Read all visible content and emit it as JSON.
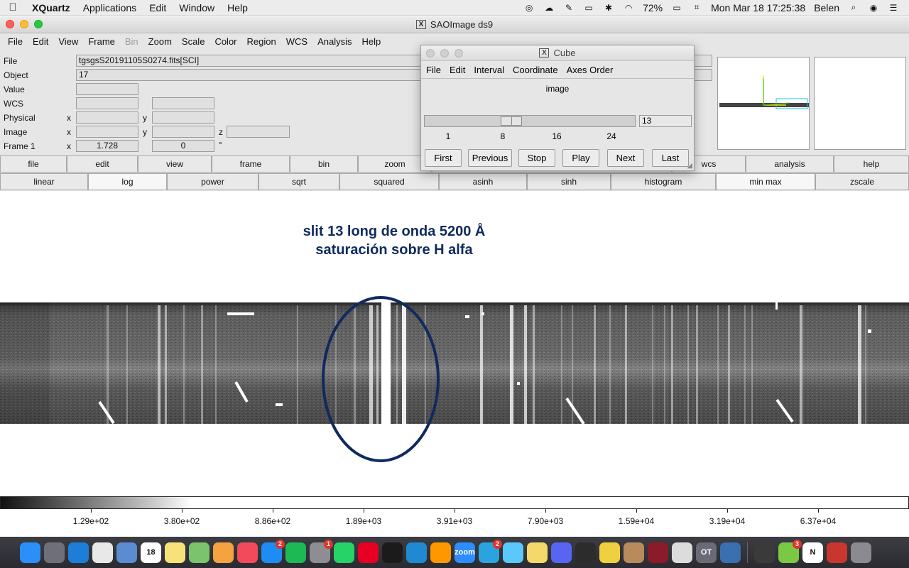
{
  "menubar": {
    "app": "XQuartz",
    "items": [
      "Applications",
      "Edit",
      "Window",
      "Help"
    ],
    "battery": "72%",
    "clock": "Mon Mar 18  17:25:38",
    "user": "Belen"
  },
  "window": {
    "title": "SAOImage ds9",
    "menu": [
      "File",
      "Edit",
      "View",
      "Frame",
      "Bin",
      "Zoom",
      "Scale",
      "Color",
      "Region",
      "WCS",
      "Analysis",
      "Help"
    ]
  },
  "info": {
    "labels": {
      "file": "File",
      "object": "Object",
      "value": "Value",
      "wcs": "WCS",
      "physical": "Physical",
      "image": "Image",
      "frame": "Frame 1",
      "x": "x",
      "y": "y",
      "z": "z",
      "deg": "°"
    },
    "file": "tgsgsS20191105S0274.fits[SCI]",
    "object": "17",
    "frame_zoom": "1.728",
    "frame_angle": "0"
  },
  "buttons": {
    "row1": [
      "file",
      "edit",
      "view",
      "frame",
      "bin",
      "zoom",
      "",
      "wcs",
      "analysis",
      "help"
    ],
    "row2": [
      "linear",
      "log",
      "power",
      "sqrt",
      "squared",
      "asinh",
      "sinh",
      "histogram",
      "min max",
      "zscale"
    ]
  },
  "annotation": {
    "line1": "slit 13 long de onda 5200 Å",
    "line2": "saturación sobre H alfa"
  },
  "colorbar": {
    "labels": [
      "1.29e+02",
      "3.80e+02",
      "8.86e+02",
      "1.89e+03",
      "3.91e+03",
      "7.90e+03",
      "1.59e+04",
      "3.19e+04",
      "6.37e+04"
    ]
  },
  "cube": {
    "title": "Cube",
    "menu": [
      "File",
      "Edit",
      "Interval",
      "Coordinate",
      "Axes Order"
    ],
    "axis": "image",
    "value": "13",
    "min": 1,
    "max": 31,
    "ticks": [
      "1",
      "8",
      "16",
      "24"
    ],
    "buttons": [
      "First",
      "Previous",
      "Stop",
      "Play",
      "Next",
      "Last"
    ]
  },
  "dock": {
    "apps": [
      {
        "name": "Finder",
        "color": "#2c8ef8",
        "icon": "finder-icon"
      },
      {
        "name": "Launchpad",
        "color": "#6f6f7a",
        "icon": "launchpad-icon"
      },
      {
        "name": "Safari",
        "color": "#1c7ed6",
        "icon": "safari-icon"
      },
      {
        "name": "Chrome",
        "color": "#e8e8e8",
        "icon": "chrome-icon"
      },
      {
        "name": "Preview",
        "color": "#5b8bd0",
        "icon": "preview-icon"
      },
      {
        "name": "Calendar",
        "color": "#ffffff",
        "icon": "calendar-icon",
        "label": "18"
      },
      {
        "name": "Notes",
        "color": "#f7e27a",
        "icon": "notes-icon"
      },
      {
        "name": "Maps",
        "color": "#7cc36d",
        "icon": "maps-icon"
      },
      {
        "name": "Photos",
        "color": "#f4a340",
        "icon": "photos-icon"
      },
      {
        "name": "Music",
        "color": "#f2495b",
        "icon": "music-icon"
      },
      {
        "name": "App Store",
        "color": "#1e8cf5",
        "icon": "app-store-icon",
        "badge": "2"
      },
      {
        "name": "Spotify",
        "color": "#1db954",
        "icon": "spotify-icon"
      },
      {
        "name": "System Preferences",
        "color": "#8d8d93",
        "icon": "system-preferences-icon",
        "badge": "1"
      },
      {
        "name": "WhatsApp",
        "color": "#25d366",
        "icon": "whatsapp-icon"
      },
      {
        "name": "Pinterest",
        "color": "#e60023",
        "icon": "pinterest-icon"
      },
      {
        "name": "Terminal",
        "color": "#1b1b1b",
        "icon": "terminal-icon"
      },
      {
        "name": "VS Code",
        "color": "#1f8ad2",
        "icon": "vscode-icon"
      },
      {
        "name": "Sublime Text",
        "color": "#ff9800",
        "icon": "sublime-icon"
      },
      {
        "name": "Zoom",
        "color": "#2d8cff",
        "icon": "zoom-icon",
        "label": "zoom"
      },
      {
        "name": "Telegram",
        "color": "#2aa3df",
        "icon": "telegram-icon",
        "badge": "2"
      },
      {
        "name": "Messages",
        "color": "#5ac8fa",
        "icon": "messages-icon"
      },
      {
        "name": "Stickies",
        "color": "#f5d86b",
        "icon": "stickies-icon"
      },
      {
        "name": "Discord",
        "color": "#5865f2",
        "icon": "discord-icon"
      },
      {
        "name": "Circle",
        "color": "#2c2c2c",
        "icon": "circle-icon"
      },
      {
        "name": "Cat",
        "color": "#f0d040",
        "icon": "cat-icon"
      },
      {
        "name": "Archive",
        "color": "#b98a5c",
        "icon": "archive-icon"
      },
      {
        "name": "Galaxy",
        "color": "#8a1c2a",
        "icon": "galaxy-icon"
      },
      {
        "name": "Paper",
        "color": "#dcdcdc",
        "icon": "paper-icon"
      },
      {
        "name": "OT",
        "color": "#6b6b78",
        "icon": "ot-icon",
        "label": "OT"
      },
      {
        "name": "Telescope",
        "color": "#3a6fb0",
        "icon": "telescope-icon"
      }
    ],
    "apps_right": [
      {
        "name": "XQuartz",
        "color": "#3a3a3a",
        "icon": "xquartz-icon"
      },
      {
        "name": "Grid",
        "color": "#7ac943",
        "icon": "grid-icon",
        "badge": "3"
      },
      {
        "name": "Notion",
        "color": "#ffffff",
        "icon": "notion-icon",
        "label": "N"
      },
      {
        "name": "Photo Booth",
        "color": "#c8362d",
        "icon": "photobooth-icon"
      },
      {
        "name": "Trash",
        "color": "#8a8a90",
        "icon": "trash-icon"
      }
    ]
  }
}
